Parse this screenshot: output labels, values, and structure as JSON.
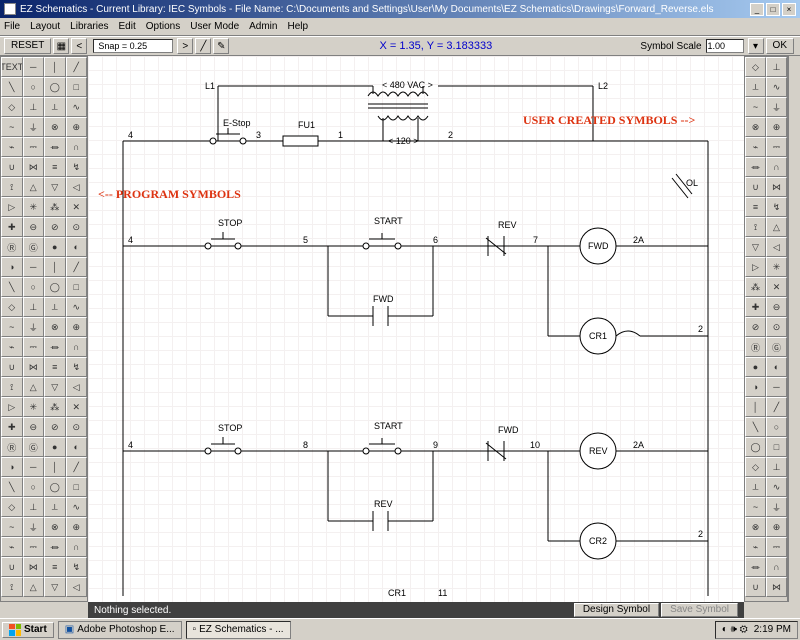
{
  "titlebar": {
    "text": "EZ Schematics - Current Library: IEC Symbols - File Name: C:\\Documents and Settings\\User\\My Documents\\EZ Schematics\\Drawings\\Forward_Reverse.els"
  },
  "menu": [
    "File",
    "Layout",
    "Libraries",
    "Edit",
    "Options",
    "User Mode",
    "Admin",
    "Help"
  ],
  "toolbar": {
    "reset": "RESET",
    "snap": "Snap = 0.25",
    "coords": "X = 1.35, Y = 3.183333",
    "scale_label": "Symbol Scale",
    "scale_value": "1.00",
    "ok": "OK"
  },
  "canvas_labels": {
    "L1": "L1",
    "L2": "L2",
    "VAC480": "< 480 VAC >",
    "V120": "< 120 >",
    "estop": "E-Stop",
    "fu1": "FU1",
    "n1": "1",
    "n2": "2",
    "n3": "3",
    "n4_a": "4",
    "n4_b": "4",
    "n4_c": "4",
    "n5": "5",
    "n6": "6",
    "n7": "7",
    "n8": "8",
    "n9": "9",
    "n10": "10",
    "n11": "11",
    "n2a_a": "2A",
    "n2a_b": "2A",
    "n2_b": "2",
    "n2_c": "2",
    "n2_d": "2",
    "stop_a": "STOP",
    "stop_b": "STOP",
    "start_a": "START",
    "start_b": "START",
    "rev_a": "REV",
    "rev_b": "REV",
    "rev_c": "REV",
    "fwd_a": "FWD",
    "fwd_b": "FWD",
    "fwd_c": "FWD",
    "cr1": "CR1",
    "cr2": "CR2",
    "cr1_b": "CR1",
    "ol": "OL"
  },
  "overlay": {
    "left": "<-- PROGRAM SYMBOLS",
    "right": "USER CREATED SYMBOLS -->"
  },
  "status": {
    "msg": "Nothing selected.",
    "design": "Design Symbol",
    "save": "Save Symbol"
  },
  "taskbar": {
    "start": "Start",
    "task1": "Adobe Photoshop E...",
    "task2": "EZ Schematics - ...",
    "time": "2:19 PM"
  },
  "left_palette_first": "TEXT"
}
